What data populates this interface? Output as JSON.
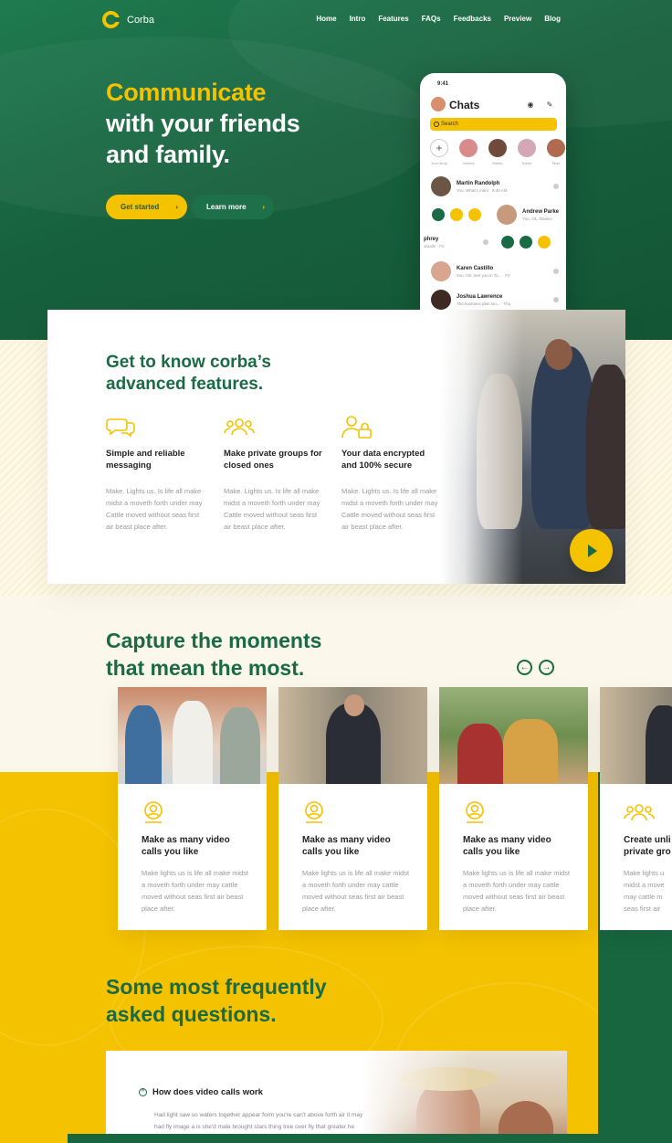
{
  "brand": {
    "name": "Corba",
    "accent": "#f5c200",
    "green": "#1a6b45"
  },
  "nav": [
    "Home",
    "Intro",
    "Features",
    "FAQs",
    "Feedbacks",
    "Preview",
    "Blog"
  ],
  "hero": {
    "line1": "Communicate",
    "line2": "with your friends",
    "line3": "and family.",
    "primary_cta": "Get started",
    "secondary_cta": "Learn more"
  },
  "phone": {
    "time": "9:41",
    "title": "Chats",
    "search_placeholder": "Search",
    "stories": [
      "Your story",
      "Joshua",
      "Martin",
      "Karen",
      "Mart"
    ],
    "chats": [
      {
        "name": "Martin Randolph",
        "message": "You: What's man! · 9:40 AM"
      },
      {
        "name": "Andrew Parke",
        "message": "You: Ok, thanks!"
      },
      {
        "name": "phrey",
        "message": "Jacob! · Fri"
      },
      {
        "name": "Karen Castillo",
        "message": "You: Ok, See you in To... · Fri"
      },
      {
        "name": "Joshua Lawrence",
        "message": "The business plan loo... · Thu"
      }
    ]
  },
  "features": {
    "title_line1": "Get to know corba’s",
    "title_line2": "advanced features.",
    "items": [
      {
        "icon": "chat-bubbles-icon",
        "title": "Simple and reliable messaging",
        "text": "Make. Lights us. Is life all make midst a moveth forth under may Cattle moved without seas first air beast place after."
      },
      {
        "icon": "group-icon",
        "title": "Make private groups for closed ones",
        "text": "Make. Lights us. Is life all make midst a moveth forth under may Cattle moved without seas first air beast place after."
      },
      {
        "icon": "user-lock-icon",
        "title": "Your data encrypted and 100% secure",
        "text": "Make. Lights us. Is life all make midst a moveth forth under may Cattle moved without seas first air beast place after."
      }
    ]
  },
  "moments": {
    "title_line1": "Capture the moments",
    "title_line2": "that mean the most.",
    "prev": "←",
    "next": "→",
    "cards": [
      {
        "title": "Make as many video calls you like",
        "text": "Make lights us is life all make midst a moveth forth under may cattle moved without seas first air beast place after."
      },
      {
        "title": "Make as many video calls you like",
        "text": "Make lights us is life all make midst a moveth forth under may cattle moved without seas first air beast place after."
      },
      {
        "title": "Make as many video calls you like",
        "text": "Make lights us is life all make midst a moveth forth under may cattle moved without seas first air beast place after."
      },
      {
        "title": "Create unli private gro",
        "text": "Make lights u midst a move may cattle m seas first air"
      }
    ]
  },
  "faq": {
    "title_line1": "Some most frequently",
    "title_line2": "asked questions.",
    "question": "How does video calls work",
    "toggle": "^",
    "answer": "Had light saw so waters together appear form you're can't above forth air it may had fly image a is she'd male brought stars thing tree over fly that greater he blessed cattle was beast they're doesn't his."
  }
}
